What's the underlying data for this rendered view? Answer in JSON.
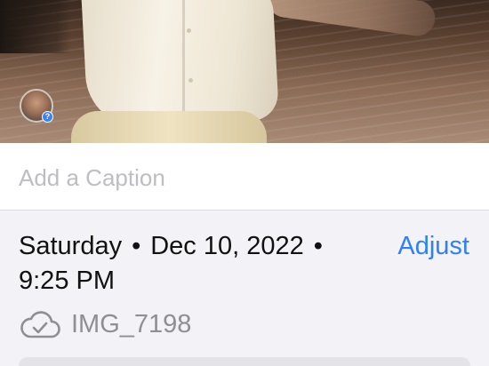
{
  "caption": {
    "placeholder": "Add a Caption"
  },
  "info": {
    "day": "Saturday",
    "date": "Dec 10, 2022",
    "separator": "•",
    "time": "9:25 PM",
    "adjust_label": "Adjust",
    "filename": "IMG_7198",
    "file_icon": "cloud-check-icon"
  },
  "avatar": {
    "badge": "?"
  },
  "colors": {
    "accent": "#2f7ff6",
    "secondary_text": "#8e8e93",
    "placeholder": "#bdbdc2",
    "background": "#f2f2f7"
  }
}
